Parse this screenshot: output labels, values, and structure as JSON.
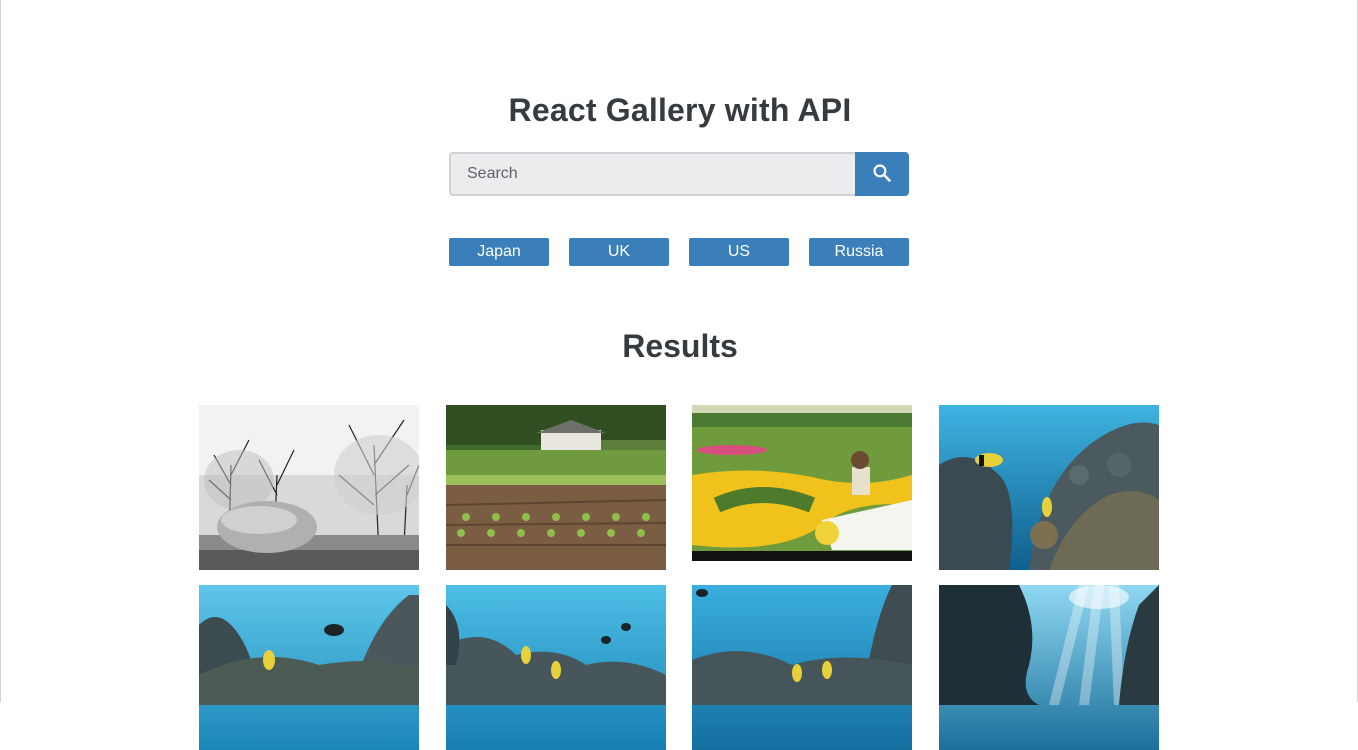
{
  "header": {
    "title": "React Gallery with API"
  },
  "search": {
    "placeholder": "Search",
    "value": "",
    "button_icon": "search-icon"
  },
  "nav": {
    "items": [
      {
        "label": "Japan"
      },
      {
        "label": "UK"
      },
      {
        "label": "US"
      },
      {
        "label": "Russia"
      }
    ]
  },
  "results": {
    "title": "Results",
    "photos": [
      {
        "subject": "black-and-white park with large stone"
      },
      {
        "subject": "vegetable field with farmhouse"
      },
      {
        "subject": "child sitting on sculpture in flower garden"
      },
      {
        "subject": "underwater reef with fish"
      },
      {
        "subject": "underwater reef with fish"
      },
      {
        "subject": "underwater reef with fish"
      },
      {
        "subject": "underwater reef with fish"
      },
      {
        "subject": "underwater rocks with sun rays"
      }
    ]
  },
  "colors": {
    "accent": "#3a7fba",
    "heading": "#363b40",
    "input_bg": "#ebecee"
  }
}
